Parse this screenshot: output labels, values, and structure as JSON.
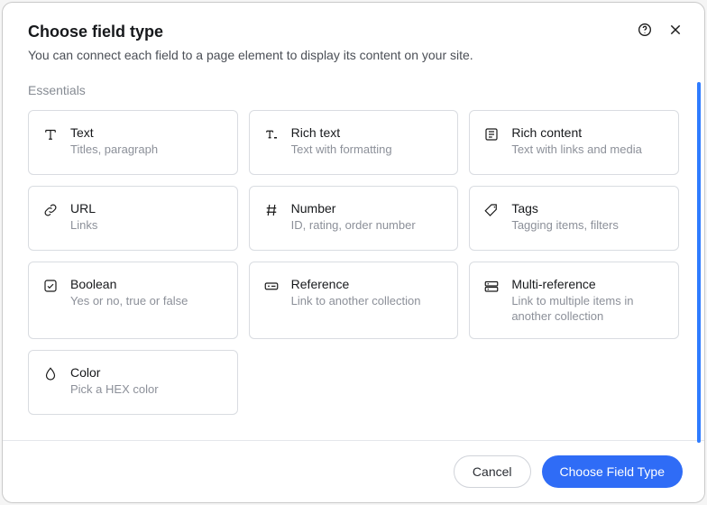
{
  "modal": {
    "title": "Choose field type",
    "subtitle": "You can connect each field to a page element to display its content on your site."
  },
  "section_label": "Essentials",
  "cards": [
    {
      "icon": "text-icon",
      "title": "Text",
      "desc": "Titles, paragraph"
    },
    {
      "icon": "rich-text-icon",
      "title": "Rich text",
      "desc": "Text with formatting"
    },
    {
      "icon": "rich-content-icon",
      "title": "Rich content",
      "desc": "Text with links and media"
    },
    {
      "icon": "url-icon",
      "title": "URL",
      "desc": "Links"
    },
    {
      "icon": "number-icon",
      "title": "Number",
      "desc": "ID, rating, order number"
    },
    {
      "icon": "tags-icon",
      "title": "Tags",
      "desc": "Tagging items, filters"
    },
    {
      "icon": "boolean-icon",
      "title": "Boolean",
      "desc": "Yes or no, true or false"
    },
    {
      "icon": "reference-icon",
      "title": "Reference",
      "desc": "Link to another collection"
    },
    {
      "icon": "multi-reference-icon",
      "title": "Multi-reference",
      "desc": "Link to multiple items in another collection"
    },
    {
      "icon": "color-icon",
      "title": "Color",
      "desc": "Pick a HEX color"
    }
  ],
  "footer": {
    "cancel": "Cancel",
    "choose": "Choose Field Type"
  }
}
